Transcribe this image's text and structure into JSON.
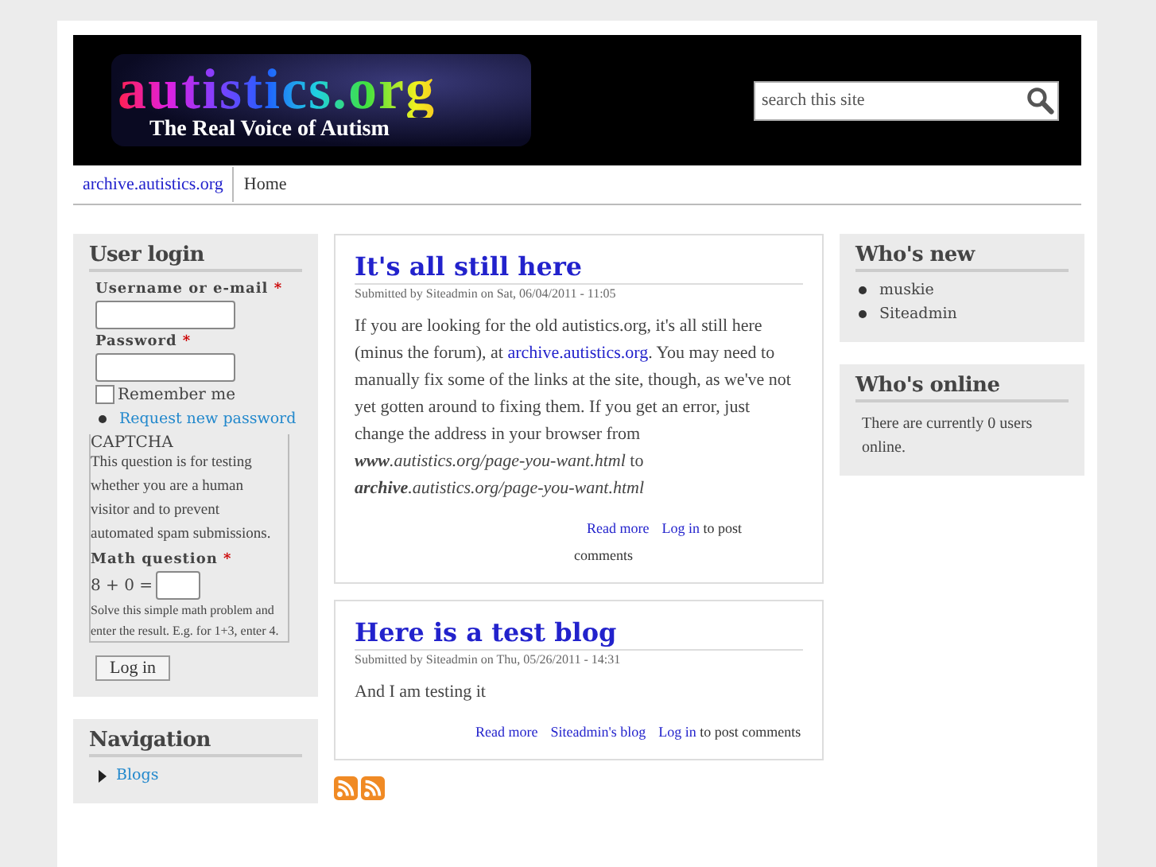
{
  "header": {
    "logo_title": "autistics.org",
    "logo_tagline": "The Real Voice of Autism",
    "search": {
      "placeholder": "search this site"
    }
  },
  "nav": [
    {
      "label": "archive.autistics.org",
      "kind": "link"
    },
    {
      "label": "Home",
      "kind": "plain"
    }
  ],
  "user_login": {
    "title": "User login",
    "username_label": "Username or e-mail",
    "password_label": "Password",
    "required_mark": "*",
    "remember": {
      "label": "Remember me",
      "checked": false
    },
    "request_password": "Request new password",
    "captcha": {
      "legend": "CAPTCHA",
      "description": "This question is for testing whether you are a human visitor and to prevent automated spam submissions.",
      "math_label": "Math question",
      "question": "8 + 0 =",
      "help": "Solve this simple math problem and enter the result. E.g. for 1+3, enter 4."
    },
    "button": "Log in"
  },
  "navigation": {
    "title": "Navigation",
    "items": [
      "Blogs"
    ]
  },
  "posts": [
    {
      "title": "It's all still here",
      "meta": "Submitted by Siteadmin on Sat, 06/04/2011 - 11:05",
      "body": [
        {
          "kind": "text",
          "text": "If you are looking for the old autistics.org, it's all still here (minus the forum), at "
        },
        {
          "kind": "link",
          "text": "archive.autistics.org"
        },
        {
          "kind": "text",
          "text": ". You may need to manually fix some of the links at the site, though, as we've not yet gotten around to fixing them. If you get an error, just change the address in your browser from "
        },
        {
          "kind": "url",
          "host": "www",
          "path": ".autistics.org/page-you-want.html"
        },
        {
          "kind": "text",
          "text": " to "
        },
        {
          "kind": "url",
          "host": "archive",
          "path": ".autistics.org/page-you-want.html"
        }
      ],
      "links": [
        {
          "label": "Read more"
        },
        {
          "label": "Log in",
          "suffix": " to post comments"
        }
      ]
    },
    {
      "title": "Here is a test blog",
      "meta": "Submitted by Siteadmin on Thu, 05/26/2011 - 14:31",
      "body": [
        {
          "kind": "text",
          "text": "And I am testing it"
        }
      ],
      "links": [
        {
          "label": "Read more"
        },
        {
          "label": "Siteadmin's blog"
        },
        {
          "label": "Log in",
          "suffix": " to post comments"
        }
      ]
    }
  ],
  "feeds": [
    {
      "kind": "rss"
    },
    {
      "kind": "rss"
    }
  ],
  "whos_new": {
    "title": "Who's new",
    "users": [
      "muskie",
      "Siteadmin"
    ]
  },
  "whos_online": {
    "title": "Who's online",
    "text": "There are currently 0 users online."
  }
}
